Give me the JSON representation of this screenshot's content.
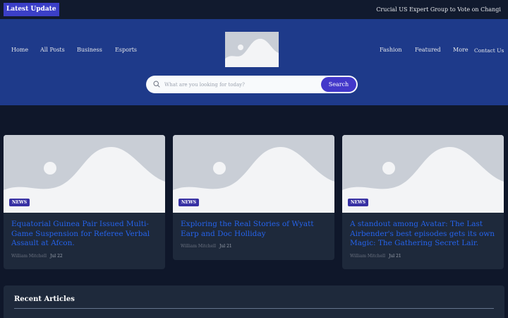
{
  "topbar": {
    "badge": "Latest Update",
    "ticker": "Crucial US Expert Group to Vote on Changi"
  },
  "nav_left": [
    "Home",
    "All Posts",
    "Business",
    "Esports"
  ],
  "nav_right": [
    "Fashion",
    "Featured",
    "More",
    "Contact Us"
  ],
  "search": {
    "placeholder": "What are you looking for today?",
    "button": "Search"
  },
  "cards": [
    {
      "tag": "NEWS",
      "title": "Equatorial Guinea Pair Issued Multi-Game Suspension for Referee Verbal Assault at Afcon.",
      "author": "William Mitchell",
      "date": "Jul 22"
    },
    {
      "tag": "NEWS",
      "title": "Exploring the Real Stories of Wyatt Earp and Doc Holliday",
      "author": "William Mitchell",
      "date": "Jul 21"
    },
    {
      "tag": "NEWS",
      "title": "A standout among Avatar: The Last Airbender's best episodes gets its own Magic: The Gathering Secret Lair.",
      "author": "William Mitchell",
      "date": "Jul 21"
    }
  ],
  "recent": {
    "title": "Recent Articles"
  },
  "colors": {
    "accent": "#4338ca",
    "header": "#1e3a8a",
    "background": "#0f172a",
    "title_link": "#2563eb"
  },
  "icons": {
    "search": "search-icon",
    "logo": "image-placeholder-icon"
  }
}
